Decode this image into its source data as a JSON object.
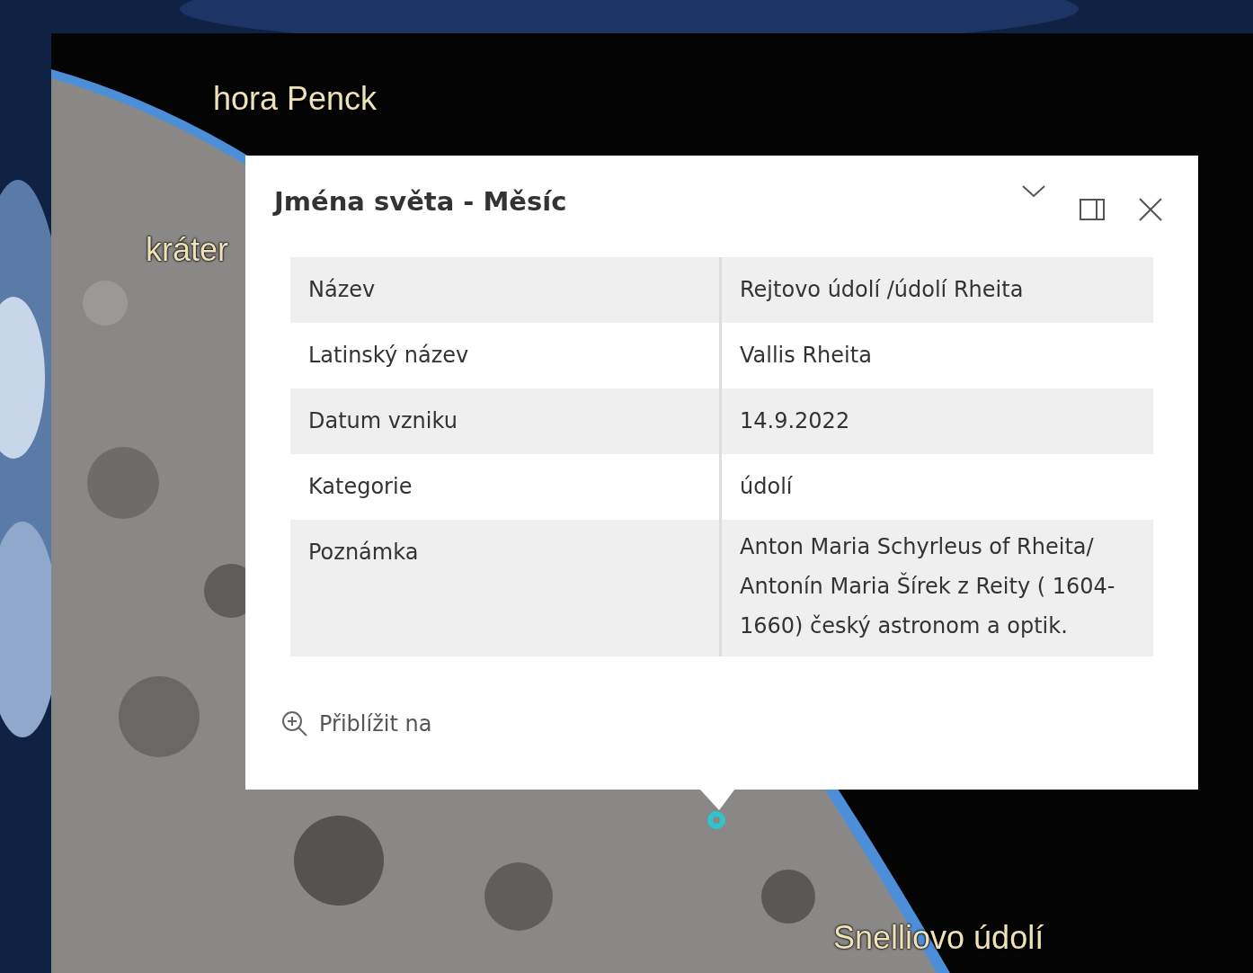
{
  "map_labels": [
    {
      "text": "hora Penck"
    },
    {
      "text": "kráter"
    },
    {
      "text": "Snelliovo údolí"
    }
  ],
  "popup": {
    "title": "Jména světa - Měsíc",
    "rows": [
      {
        "field": "Název",
        "value": "Rejtovo údolí /údolí Rheita"
      },
      {
        "field": "Latinský název",
        "value": "Vallis Rheita"
      },
      {
        "field": "Datum vzniku",
        "value": "14.9.2022"
      },
      {
        "field": "Kategorie",
        "value": "údolí"
      },
      {
        "field": "Poznámka",
        "value": "Anton Maria Schyrleus of Rheita/ Antonín Maria Šírek z Reity ( 1604-1660) český astronom a optik."
      }
    ],
    "zoom_action": "Přiblížit na"
  }
}
